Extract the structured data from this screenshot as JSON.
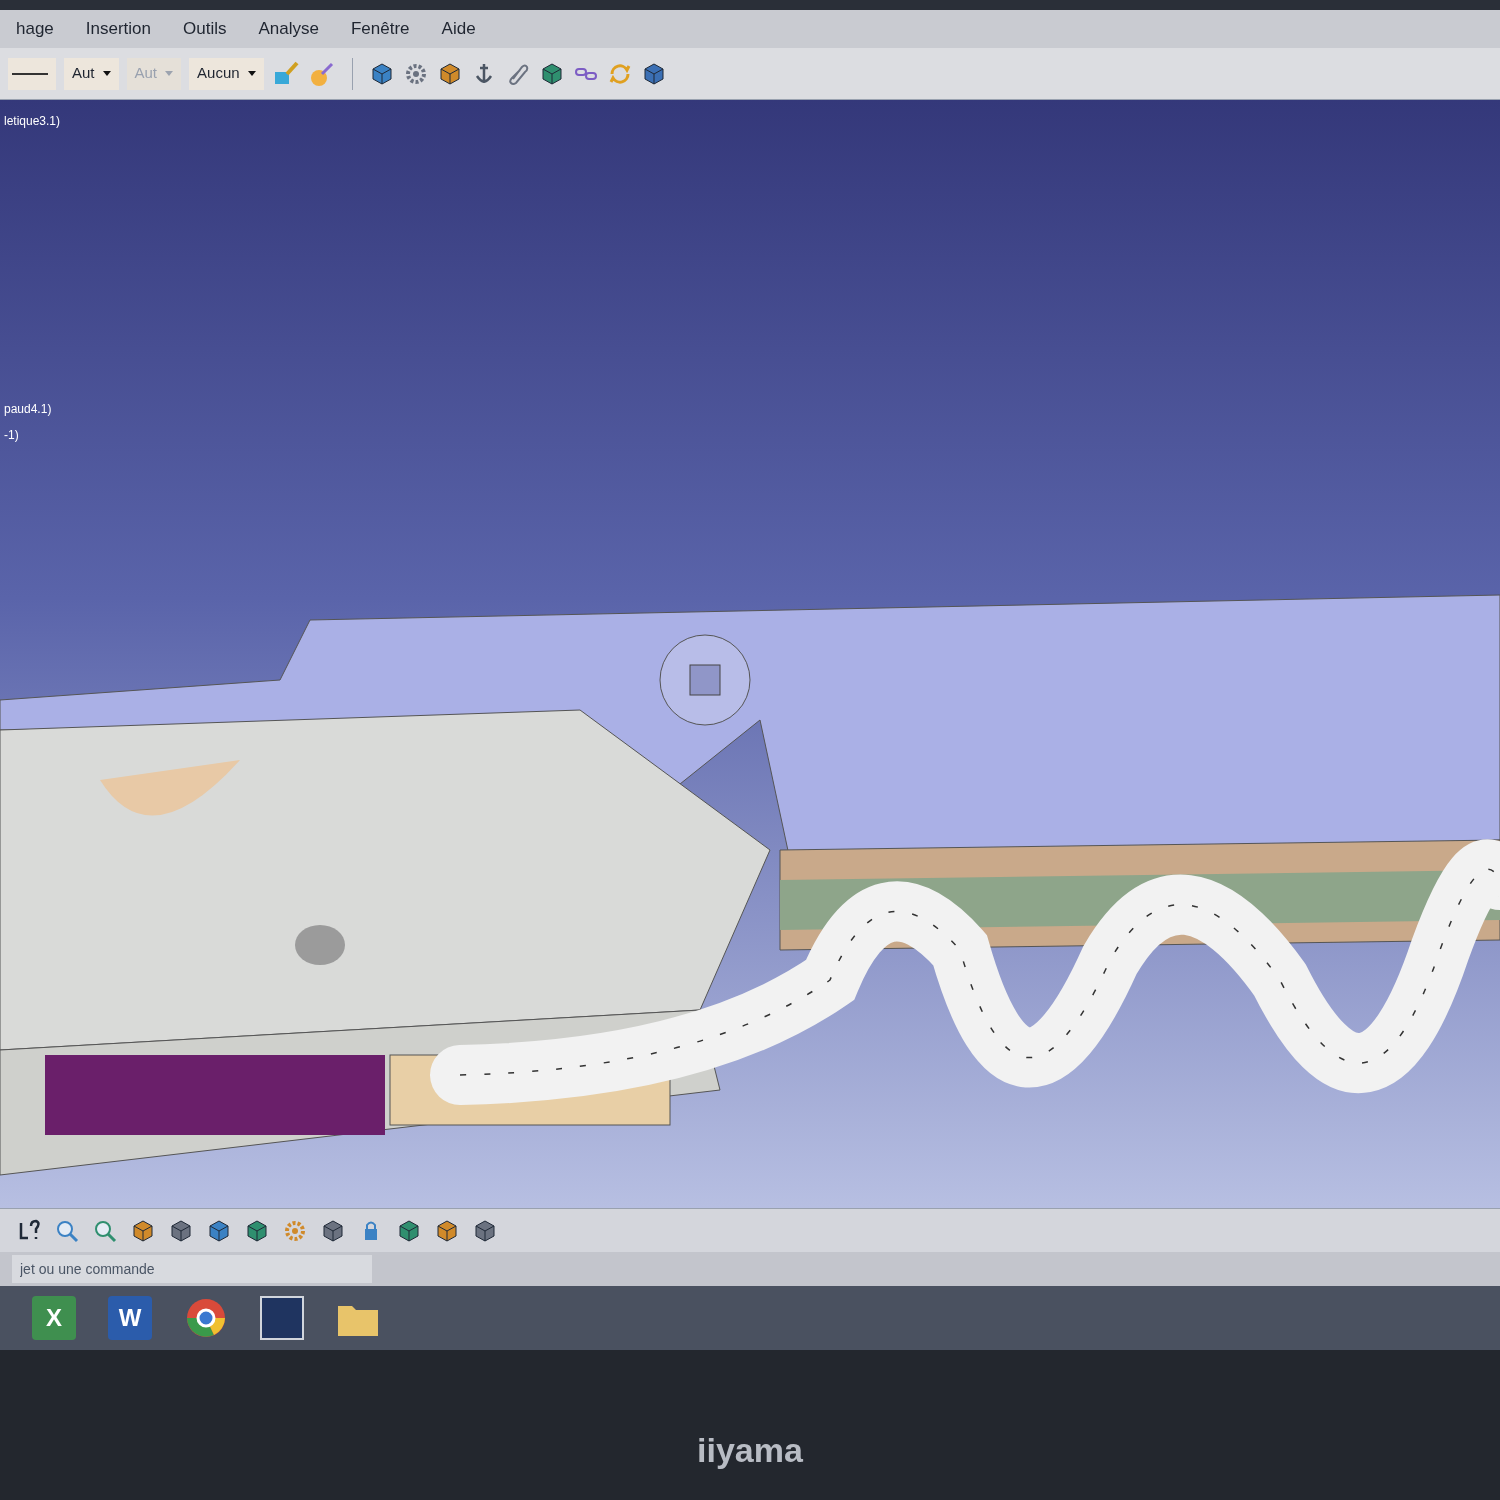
{
  "menu": [
    {
      "label": "hage"
    },
    {
      "label": "Insertion"
    },
    {
      "label": "Outils"
    },
    {
      "label": "Analyse"
    },
    {
      "label": "Fenêtre"
    },
    {
      "label": "Aide"
    }
  ],
  "toolbar": {
    "dropdowns": [
      {
        "value": "Aut",
        "disabled": false
      },
      {
        "value": "Aut",
        "disabled": true
      },
      {
        "value": "Aucun",
        "disabled": false
      }
    ]
  },
  "tree": [
    {
      "label": "letique3.1)"
    },
    {
      "label": "paud4.1)"
    },
    {
      "label": "-1)"
    }
  ],
  "command": {
    "placeholder": "jet ou une commande"
  },
  "taskbar": [
    {
      "kind": "letter",
      "label": "X",
      "color": "#3f8f4f"
    },
    {
      "kind": "letter",
      "label": "W",
      "color": "#2b5cab"
    },
    {
      "kind": "browser"
    },
    {
      "kind": "image"
    },
    {
      "kind": "folder"
    }
  ],
  "monitor": {
    "brand": "iiyama"
  }
}
